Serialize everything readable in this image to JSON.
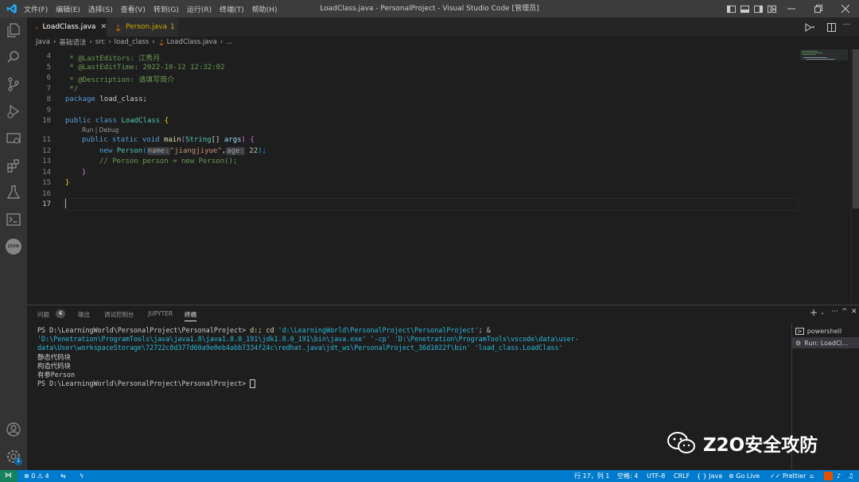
{
  "titlebar": {
    "menu": [
      "文件(F)",
      "编辑(E)",
      "选择(S)",
      "查看(V)",
      "转到(G)",
      "运行(R)",
      "终端(T)",
      "帮助(H)"
    ],
    "title": "LoadClass.java - PersonalProject - Visual Studio Code [管理员]"
  },
  "tabs": [
    {
      "label": "LoadClass.java",
      "active": true
    },
    {
      "label": "Person.java",
      "badge": "1",
      "active": false
    }
  ],
  "breadcrumb": [
    "Java",
    "›",
    "基础语法",
    "›",
    "src",
    "›",
    "load_class",
    "›",
    "LoadClass.java",
    "›",
    "..."
  ],
  "editor": {
    "line_numbers": [
      "4",
      "5",
      "6",
      "7",
      "8",
      "9",
      "10",
      "11",
      "12",
      "13",
      "14",
      "15",
      "16",
      "17"
    ],
    "l4": " * @LastEditors: 江秀月",
    "l5": " * @LastEditTime: 2022-10-12 12:32:02",
    "l6": " * @Description: 请填写简介",
    "l7": " */",
    "l8_kw": "package",
    "l8_rest": " load_class;",
    "l10_kw": "public class",
    "l10_cls": "LoadClass",
    "codelens": "Run | Debug",
    "l11_kw": "public static void",
    "l11_fn": "main",
    "l11_type": "String",
    "l11_arr": "[]",
    "l11_var": "args",
    "l12_kw": "new",
    "l12_cls": "Person",
    "l12_hint1": "name:",
    "l12_str": "\"jiangjiyue\"",
    "l12_hint2": "age:",
    "l12_num": "22",
    "l13": "// Person person = new Person();",
    "open_brace": "{",
    "close_brace": "}",
    "open_paren": "(",
    "close_paren": ")",
    "paren_semi": ");",
    "comma": ","
  },
  "panel": {
    "tabs": [
      "问题",
      "输出",
      "调试控制台",
      "JUPYTER",
      "终端"
    ],
    "problems_count": "4",
    "terminal": {
      "prompt": "PS D:\\LearningWorld\\PersonalProject\\PersonalProject>",
      "cmd_a": " d:; cd ",
      "cmd_path": "'d:\\LearningWorld\\PersonalProject\\PersonalProject'",
      "cmd_b": "; & ",
      "cmd_java": "'D:\\Penetration\\ProgramTools\\java\\java1.8\\java1.8.0_191\\jdk1.8.0_191\\bin\\java.exe'",
      "cmd_cp": " '-cp' ",
      "cmd_cp_path": "'D:\\Penetration\\ProgramTools\\vscode\\data\\user-data\\User\\workspaceStorage\\72722c8d377d60a9e0eb4abb7334f24c\\redhat.java\\jdt_ws\\PersonalProject_36d1022f\\bin'",
      "cmd_sp": " ",
      "cmd_main": "'load_class.LoadClass'",
      "out1": "静态代码块",
      "out2": "构造代码块",
      "out3": "有参Person",
      "prompt2": "PS D:\\LearningWorld\\PersonalProject\\PersonalProject>"
    },
    "terminal_list": [
      "powershell",
      "Run: LoadCl..."
    ]
  },
  "status": {
    "errors": "0",
    "warnings": "4",
    "position": "行 17，列 1",
    "spaces": "空格: 4",
    "encoding": "UTF-8",
    "eol": "CRLF",
    "language": "{ } Java",
    "golive": "Go Live",
    "prettier": "Prettier",
    "account_badge": "1"
  },
  "watermark": "Z2O安全攻防",
  "activity_json_label": "JSON",
  "colors": {
    "accent": "#007acc",
    "titlebar": "#3c3c3c",
    "activity": "#333333",
    "editor": "#1e1e1e"
  }
}
